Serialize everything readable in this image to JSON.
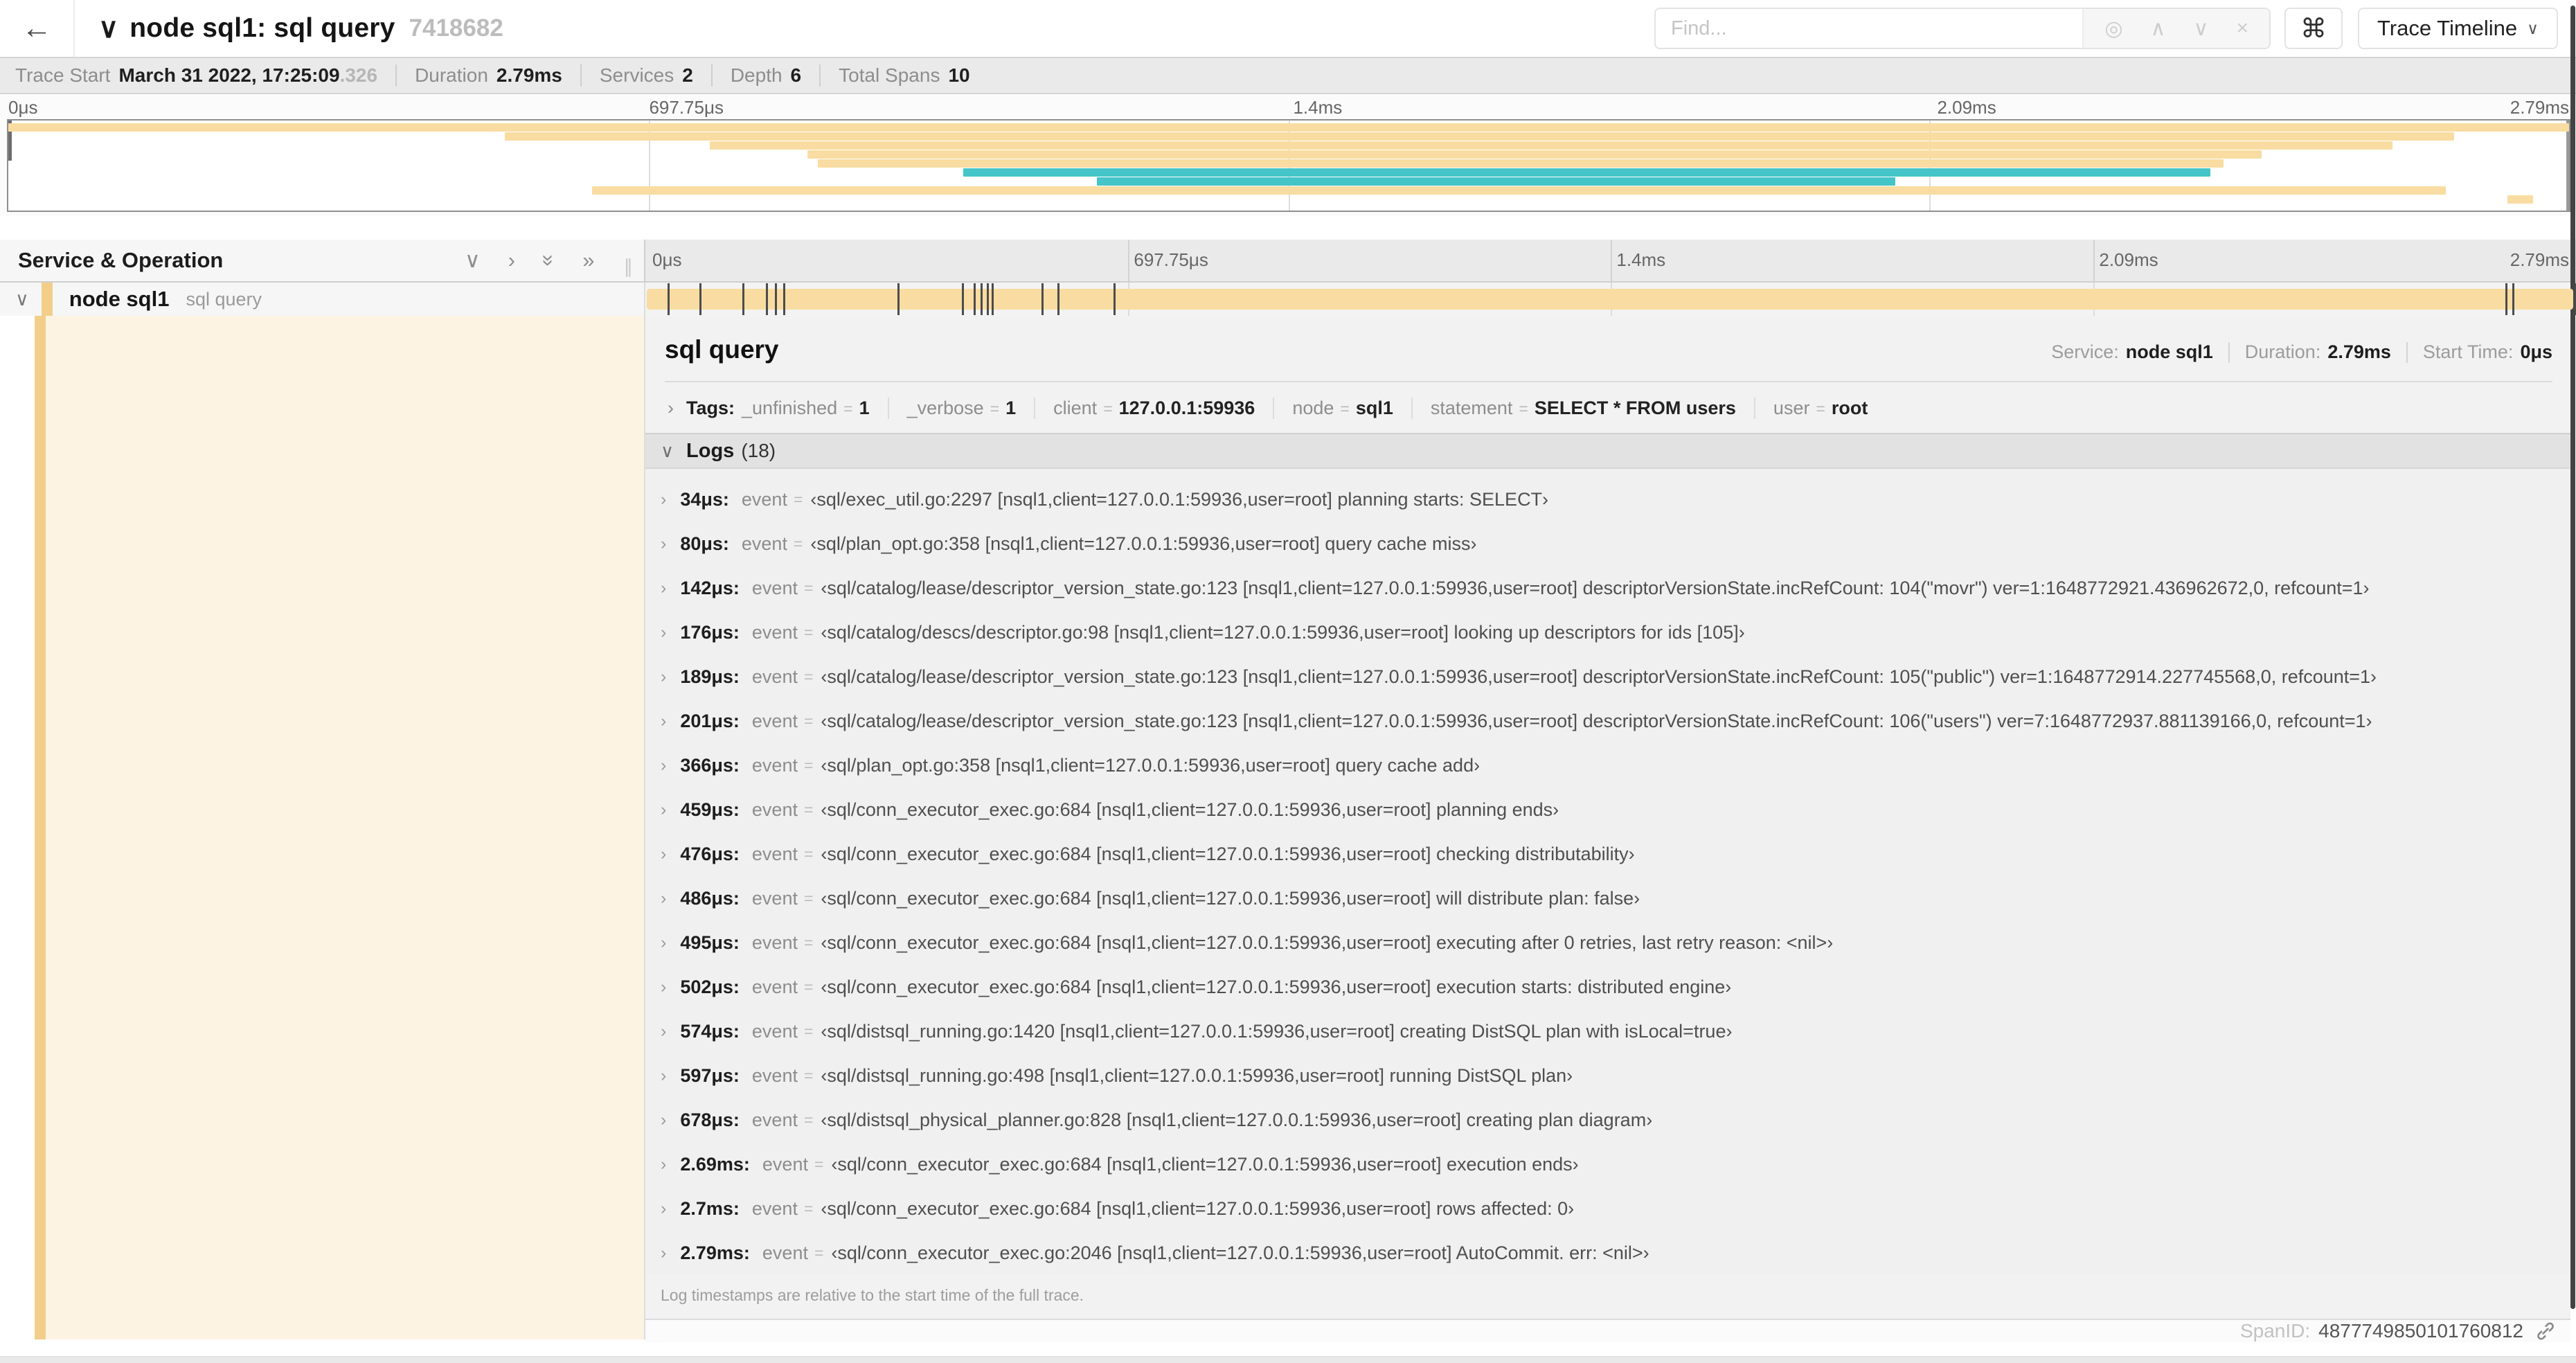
{
  "misc": {
    "equals": "=",
    "chevron_right": "›",
    "chevron_down": "∨"
  },
  "colors": {
    "orange": "#F8DCA1",
    "teal": "#45C5C7",
    "accent": "#F2CE8A",
    "cream": "#FCF3E2"
  },
  "header": {
    "back_icon": "←",
    "collapse_icon": "∨",
    "title": "node sql1: sql query",
    "trace_id": "7418682",
    "find": {
      "placeholder": "Find...",
      "locate_icon": "◎",
      "prev_icon": "∧",
      "next_icon": "∨",
      "clear_icon": "×"
    },
    "shortcut_icon": "⌘",
    "view_selector": {
      "label": "Trace Timeline",
      "caret": "∨"
    }
  },
  "summary": {
    "items": [
      {
        "label": "Trace Start",
        "value": "March 31 2022, 17:25:09",
        "suffix": ".326"
      },
      {
        "label": "Duration",
        "value": "2.79ms"
      },
      {
        "label": "Services",
        "value": "2"
      },
      {
        "label": "Depth",
        "value": "6"
      },
      {
        "label": "Total Spans",
        "value": "10"
      }
    ]
  },
  "minimap": {
    "axis_labels": [
      "0μs",
      "697.75μs",
      "1.4ms",
      "2.09ms",
      "2.79ms"
    ],
    "spans": [
      {
        "start_pct": 0,
        "end_pct": 100,
        "color": "orange"
      },
      {
        "start_pct": 19.4,
        "end_pct": 95.5,
        "color": "orange"
      },
      {
        "start_pct": 27.4,
        "end_pct": 93.1,
        "color": "orange"
      },
      {
        "start_pct": 31.2,
        "end_pct": 88.0,
        "color": "orange"
      },
      {
        "start_pct": 31.6,
        "end_pct": 86.5,
        "color": "orange"
      },
      {
        "start_pct": 37.3,
        "end_pct": 86.0,
        "color": "teal"
      },
      {
        "start_pct": 42.5,
        "end_pct": 73.7,
        "color": "teal"
      },
      {
        "start_pct": 22.8,
        "end_pct": 95.2,
        "color": "orange"
      },
      {
        "start_pct": 97.6,
        "end_pct": 98.6,
        "color": "orange"
      }
    ]
  },
  "timeline": {
    "column_header": "Service & Operation",
    "collapse_one_icon": "∨",
    "expand_one_icon": "›",
    "collapse_all_icon": "»",
    "expand_all_icon": "»",
    "resizer_grip": "∥",
    "axis_ticks": [
      "0μs",
      "697.75μs",
      "1.4ms",
      "2.09ms",
      "2.79ms"
    ],
    "total_us": 2790,
    "row": {
      "collapse_icon": "∨",
      "service": "node sql1",
      "operation": "sql query"
    }
  },
  "detail": {
    "title": "sql query",
    "meta": [
      {
        "label": "Service:",
        "value": "node sql1"
      },
      {
        "label": "Duration:",
        "value": "2.79ms"
      },
      {
        "label": "Start Time:",
        "value": "0μs"
      }
    ],
    "tags": {
      "chevron": "›",
      "label": "Tags:",
      "items": [
        {
          "key": "_unfinished",
          "value": "1"
        },
        {
          "key": "_verbose",
          "value": "1"
        },
        {
          "key": "client",
          "value": "127.0.0.1:59936"
        },
        {
          "key": "node",
          "value": "sql1"
        },
        {
          "key": "statement",
          "value": "SELECT * FROM users"
        },
        {
          "key": "user",
          "value": "root"
        }
      ]
    },
    "logs": {
      "chevron": "∨",
      "label": "Logs",
      "count": "(18)",
      "footnote": "Log timestamps are relative to the start time of the full trace.",
      "items": [
        {
          "time": "34μs:",
          "t_us": 34,
          "key": "event",
          "value": "‹sql/exec_util.go:2297 [nsql1,client=127.0.0.1:59936,user=root] planning starts: SELECT›"
        },
        {
          "time": "80μs:",
          "t_us": 80,
          "key": "event",
          "value": "‹sql/plan_opt.go:358 [nsql1,client=127.0.0.1:59936,user=root] query cache miss›"
        },
        {
          "time": "142μs:",
          "t_us": 142,
          "key": "event",
          "value": "‹sql/catalog/lease/descriptor_version_state.go:123 [nsql1,client=127.0.0.1:59936,user=root] descriptorVersionState.incRefCount: 104(\"movr\") ver=1:1648772921.436962672,0, refcount=1›"
        },
        {
          "time": "176μs:",
          "t_us": 176,
          "key": "event",
          "value": "‹sql/catalog/descs/descriptor.go:98 [nsql1,client=127.0.0.1:59936,user=root] looking up descriptors for ids [105]›"
        },
        {
          "time": "189μs:",
          "t_us": 189,
          "key": "event",
          "value": "‹sql/catalog/lease/descriptor_version_state.go:123 [nsql1,client=127.0.0.1:59936,user=root] descriptorVersionState.incRefCount: 105(\"public\") ver=1:1648772914.227745568,0, refcount=1›"
        },
        {
          "time": "201μs:",
          "t_us": 201,
          "key": "event",
          "value": "‹sql/catalog/lease/descriptor_version_state.go:123 [nsql1,client=127.0.0.1:59936,user=root] descriptorVersionState.incRefCount: 106(\"users\") ver=7:1648772937.881139166,0, refcount=1›"
        },
        {
          "time": "366μs:",
          "t_us": 366,
          "key": "event",
          "value": "‹sql/plan_opt.go:358 [nsql1,client=127.0.0.1:59936,user=root] query cache add›"
        },
        {
          "time": "459μs:",
          "t_us": 459,
          "key": "event",
          "value": "‹sql/conn_executor_exec.go:684 [nsql1,client=127.0.0.1:59936,user=root] planning ends›"
        },
        {
          "time": "476μs:",
          "t_us": 476,
          "key": "event",
          "value": "‹sql/conn_executor_exec.go:684 [nsql1,client=127.0.0.1:59936,user=root] checking distributability›"
        },
        {
          "time": "486μs:",
          "t_us": 486,
          "key": "event",
          "value": "‹sql/conn_executor_exec.go:684 [nsql1,client=127.0.0.1:59936,user=root] will distribute plan: false›"
        },
        {
          "time": "495μs:",
          "t_us": 495,
          "key": "event",
          "value": "‹sql/conn_executor_exec.go:684 [nsql1,client=127.0.0.1:59936,user=root] executing after 0 retries, last retry reason: <nil>›"
        },
        {
          "time": "502μs:",
          "t_us": 502,
          "key": "event",
          "value": "‹sql/conn_executor_exec.go:684 [nsql1,client=127.0.0.1:59936,user=root] execution starts: distributed engine›"
        },
        {
          "time": "574μs:",
          "t_us": 574,
          "key": "event",
          "value": "‹sql/distsql_running.go:1420 [nsql1,client=127.0.0.1:59936,user=root] creating DistSQL plan with isLocal=true›"
        },
        {
          "time": "597μs:",
          "t_us": 597,
          "key": "event",
          "value": "‹sql/distsql_running.go:498 [nsql1,client=127.0.0.1:59936,user=root] running DistSQL plan›"
        },
        {
          "time": "678μs:",
          "t_us": 678,
          "key": "event",
          "value": "‹sql/distsql_physical_planner.go:828 [nsql1,client=127.0.0.1:59936,user=root] creating plan diagram›"
        },
        {
          "time": "2.69ms:",
          "t_us": 2690,
          "key": "event",
          "value": "‹sql/conn_executor_exec.go:684 [nsql1,client=127.0.0.1:59936,user=root] execution ends›"
        },
        {
          "time": "2.7ms:",
          "t_us": 2700,
          "key": "event",
          "value": "‹sql/conn_executor_exec.go:684 [nsql1,client=127.0.0.1:59936,user=root] rows affected: 0›"
        },
        {
          "time": "2.79ms:",
          "t_us": 2790,
          "key": "event",
          "value": "‹sql/conn_executor_exec.go:2046 [nsql1,client=127.0.0.1:59936,user=root] AutoCommit. err: <nil>›"
        }
      ]
    },
    "footer": {
      "label": "SpanID:",
      "value": "4877749850101760812"
    }
  }
}
